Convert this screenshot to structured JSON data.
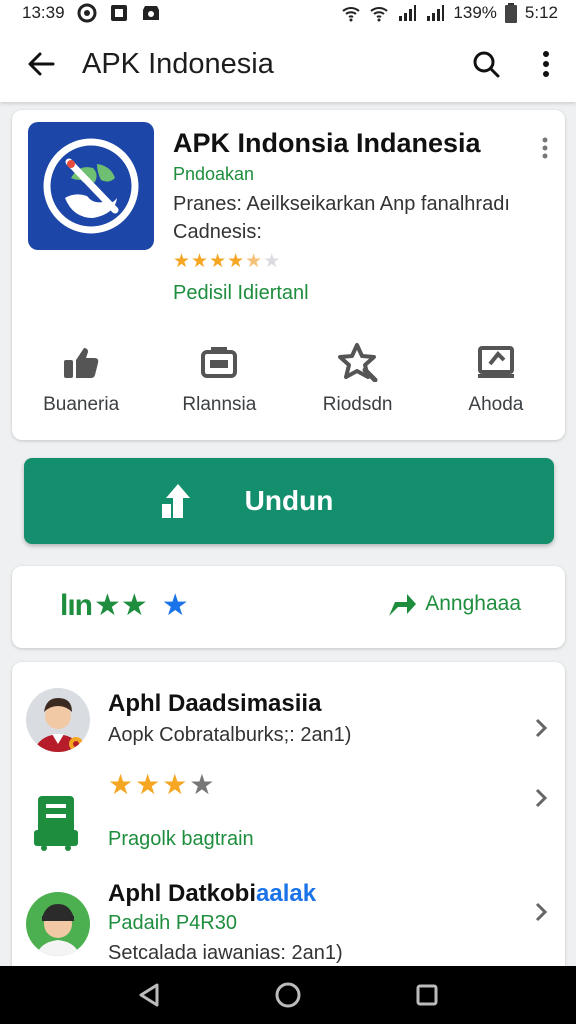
{
  "status_bar": {
    "time_left": "13:39",
    "battery": "139%",
    "time_right": "5:12"
  },
  "toolbar": {
    "title": "APK Indonesia"
  },
  "app": {
    "name": "APK Indonsia Indanesia",
    "developer": "Pndoakan",
    "description_line1": "Pranes: Aeilkseikarkan Anp fanalhradı",
    "description_line2": "Cadnesis:",
    "rating_stars": 4.5,
    "status": "Pedisil Idiertanl"
  },
  "actions": [
    {
      "label": "Buaneria",
      "icon": "share-icon"
    },
    {
      "label": "Rlannsia",
      "icon": "wallet-icon"
    },
    {
      "label": "Riodsdn",
      "icon": "star-badge-icon"
    },
    {
      "label": "Ahoda",
      "icon": "screen-icon"
    }
  ],
  "install_button": {
    "label": "Undun"
  },
  "rating_row": {
    "label": "lın",
    "green_stars": "★★",
    "blue_star": "★",
    "link_label": "Annghaaa"
  },
  "list": [
    {
      "title": "Aphl Daadsimasiia",
      "subtitle": "Aopk Cobratalburks;: 2an1)"
    },
    {
      "stars": 3,
      "status": "Pragolk bagtrain"
    },
    {
      "title_black": "Aphl Datkobi",
      "title_blue": "aalak",
      "subtitle_green": "Padaih P4R30",
      "subtitle": "Setcalada iawanias: 2an1)"
    }
  ],
  "colors": {
    "accent_green": "#1e8e3e",
    "install_green": "#138f6e",
    "star_orange": "#f5a623",
    "blue": "#1a73e8",
    "app_icon_bg": "#1c47a8"
  }
}
